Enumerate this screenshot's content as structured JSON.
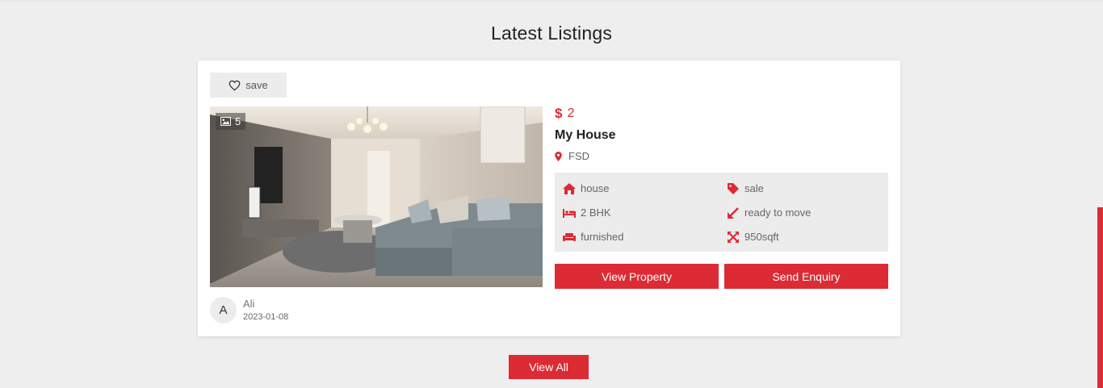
{
  "section": {
    "title": "Latest Listings"
  },
  "listing": {
    "save_label": "save",
    "photo_count": "5",
    "price_symbol": "$",
    "price": "2",
    "title": "My House",
    "location": "FSD",
    "features": {
      "type": "house",
      "purpose": "sale",
      "bedrooms": "2 BHK",
      "status": "ready to move",
      "furnishing": "furnished",
      "area": "950sqft"
    },
    "view_label": "View Property",
    "enquiry_label": "Send Enquiry",
    "author": {
      "initial": "A",
      "name": "Ali",
      "date": "2023-01-08"
    }
  },
  "footer": {
    "view_all_label": "View All"
  },
  "colors": {
    "accent": "#dc2b35",
    "page_bg": "#eeeeee",
    "panel_bg": "#ececec"
  },
  "icons": [
    "heart-icon",
    "image-icon",
    "map-pin-icon",
    "home-icon",
    "tag-icon",
    "bed-icon",
    "arrow-icon",
    "sofa-icon",
    "expand-icon"
  ]
}
